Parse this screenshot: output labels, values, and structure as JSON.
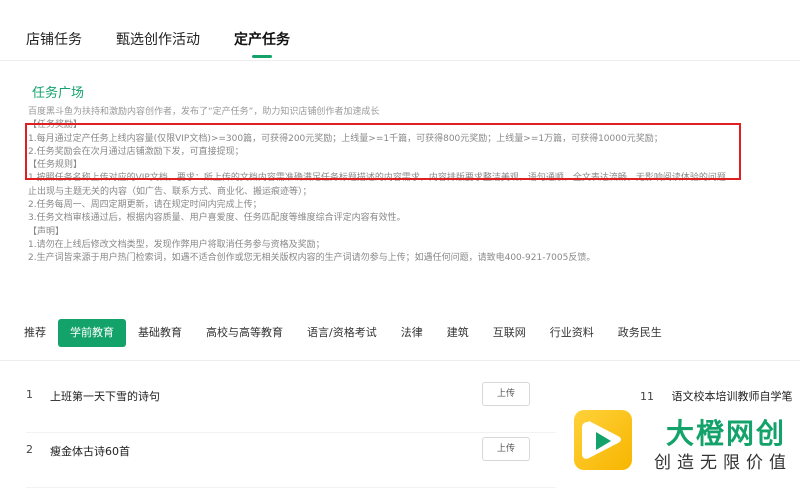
{
  "top_tabs": [
    "店铺任务",
    "甄选创作活动",
    "定产任务"
  ],
  "plaza": {
    "title": "任务广场",
    "lines": [
      "百度黑斗鱼为扶持和激励内容创作者，发布了“定产任务”，助力知识店铺创作者加速成长",
      "【任务奖励】",
      "1.每月通过定产任务上线内容量(仅限VIP文档)>=300篇，可获得200元奖励；上线量>=1千篇，可获得800元奖励；上线量>=1万篇，可获得10000元奖励；",
      "2.任务奖励会在次月通过店铺激励下发，可直接提现；",
      "【任务规则】",
      "1.按照任务名称上传对应的VIP文档，要求：所上传的文档内容需准确满足任务标题描述的内容需求，内容排版要求整洁美观，语句通顺，全文表达流畅，无影响阅读体验的问题",
      "止出现与主题无关的内容（如广告、联系方式、商业化、搬运痕迹等）；",
      "2.任务每周一、周四定期更新，请在规定时间内完成上传；",
      "3.任务文档审核通过后，根据内容质量、用户喜爱度、任务匹配度等维度综合评定内容有效性。",
      "【声明】",
      "1.请勿在上线后修改文档类型，发现作弊用户将取消任务参与资格及奖励；",
      "2.生产词皆来源于用户热门检索词，如遇不适合创作或您无相关版权内容的生产词请勿参与上传；如遇任何问题，请致电400-921-7005反馈。"
    ]
  },
  "categories": [
    "推荐",
    "学前教育",
    "基础教育",
    "高校与高等教育",
    "语言/资格考试",
    "法律",
    "建筑",
    "互联网",
    "行业资料",
    "政务民生"
  ],
  "tasks": [
    {
      "idx": "1",
      "name": "上班第一天下雪的诗句",
      "button": "上传"
    },
    {
      "idx": "2",
      "name": "瘦金体古诗60首",
      "button": "上传"
    }
  ],
  "right_task": {
    "idx": "11",
    "name": "语文校本培训教师自学笔"
  },
  "watermark": {
    "name": "大橙网创",
    "slogan": "创造无限价值"
  },
  "colors": {
    "accent": "#14a26b",
    "highlight": "#e02020",
    "logo": "#f7b500"
  }
}
